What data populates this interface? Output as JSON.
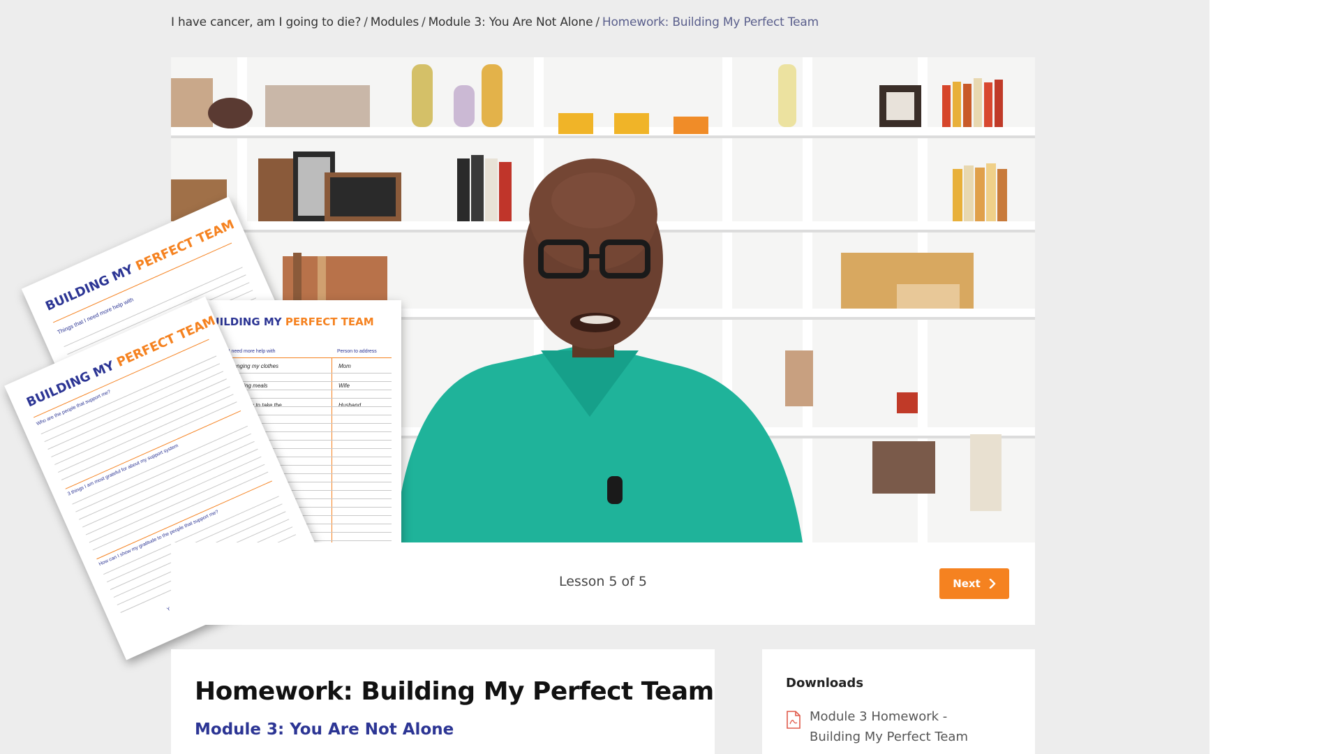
{
  "breadcrumb": {
    "items": [
      "I have cancer, am I going to die?",
      "Modules",
      "Module 3: You Are Not Alone"
    ],
    "current": "Homework: Building My Perfect Team",
    "separator": "/"
  },
  "lesson_bar": {
    "counter": "Lesson 5 of 5",
    "next_label": "Next"
  },
  "lesson": {
    "title": "Homework: Building My Perfect Team",
    "module": "Module 3: You Are Not Alone"
  },
  "downloads": {
    "heading": "Downloads",
    "items": [
      {
        "label": "Module 3 Homework - Building My Perfect Team",
        "icon": "pdf-file-icon"
      }
    ]
  },
  "worksheet": {
    "title_part1": "BUILDING MY",
    "title_part2": "PERFECT TEAM",
    "col1": "Things that I need more help with",
    "col2": "Person to address",
    "rows": [
      {
        "task": "Help with changing my clothes",
        "person": "Mom"
      },
      {
        "task": "Help with preparing meals",
        "person": "Wife"
      },
      {
        "task": "To be strong enough to take the",
        "person": "Husband"
      }
    ],
    "q1": "Who are the people that support me?",
    "q2": "3 things I am most grateful for about my support system",
    "q3": "How can I show my gratitude to the people that support me?",
    "footer": "YOU ARE NOT ALONE IN THIS"
  },
  "colors": {
    "accent": "#f58220",
    "brand_blue": "#2c3594",
    "breadcrumb_current": "#5a5f8c",
    "page_bg": "#ededed"
  }
}
